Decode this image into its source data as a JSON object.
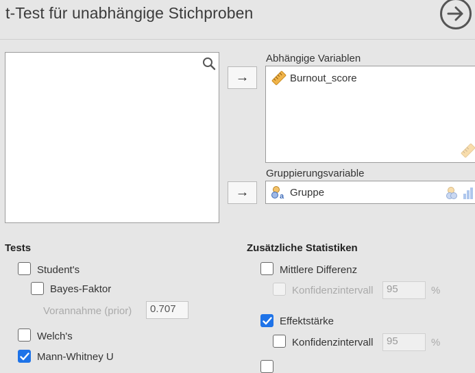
{
  "header": {
    "title": "t-Test für unabhängige Stichproben"
  },
  "icons": {
    "go": "arrow-right-circle-icon",
    "search": "search-icon",
    "scale": "ruler-icon",
    "nominal": "nominal-variable-icon"
  },
  "assign": {
    "dependent_label": "Abhängige Variablen",
    "dependent_items": [
      "Burnout_score"
    ],
    "grouping_label": "Gruppierungsvariable",
    "grouping_value": "Gruppe",
    "arrow": "→"
  },
  "tests": {
    "heading": "Tests",
    "student": "Student's",
    "bayes": "Bayes-Faktor",
    "prior_label": "Vorannahme (prior)",
    "prior_value": "0.707",
    "welch": "Welch's",
    "mann_whitney": "Mann-Whitney U"
  },
  "stats": {
    "heading": "Zusätzliche Statistiken",
    "mean_diff": "Mittlere Differenz",
    "ci_label": "Konfidenzintervall",
    "ci_value_1": "95",
    "pct": "%",
    "effect_size": "Effektstärke",
    "ci_value_2": "95"
  },
  "state": {
    "student": false,
    "bayes": false,
    "welch": false,
    "mann_whitney": true,
    "mean_diff": false,
    "ci1": false,
    "effect_size": true,
    "ci2": false
  },
  "colors": {
    "checked": "#1e73e8",
    "background": "#e6e6e6",
    "scale_icon": "#e8a43a"
  }
}
